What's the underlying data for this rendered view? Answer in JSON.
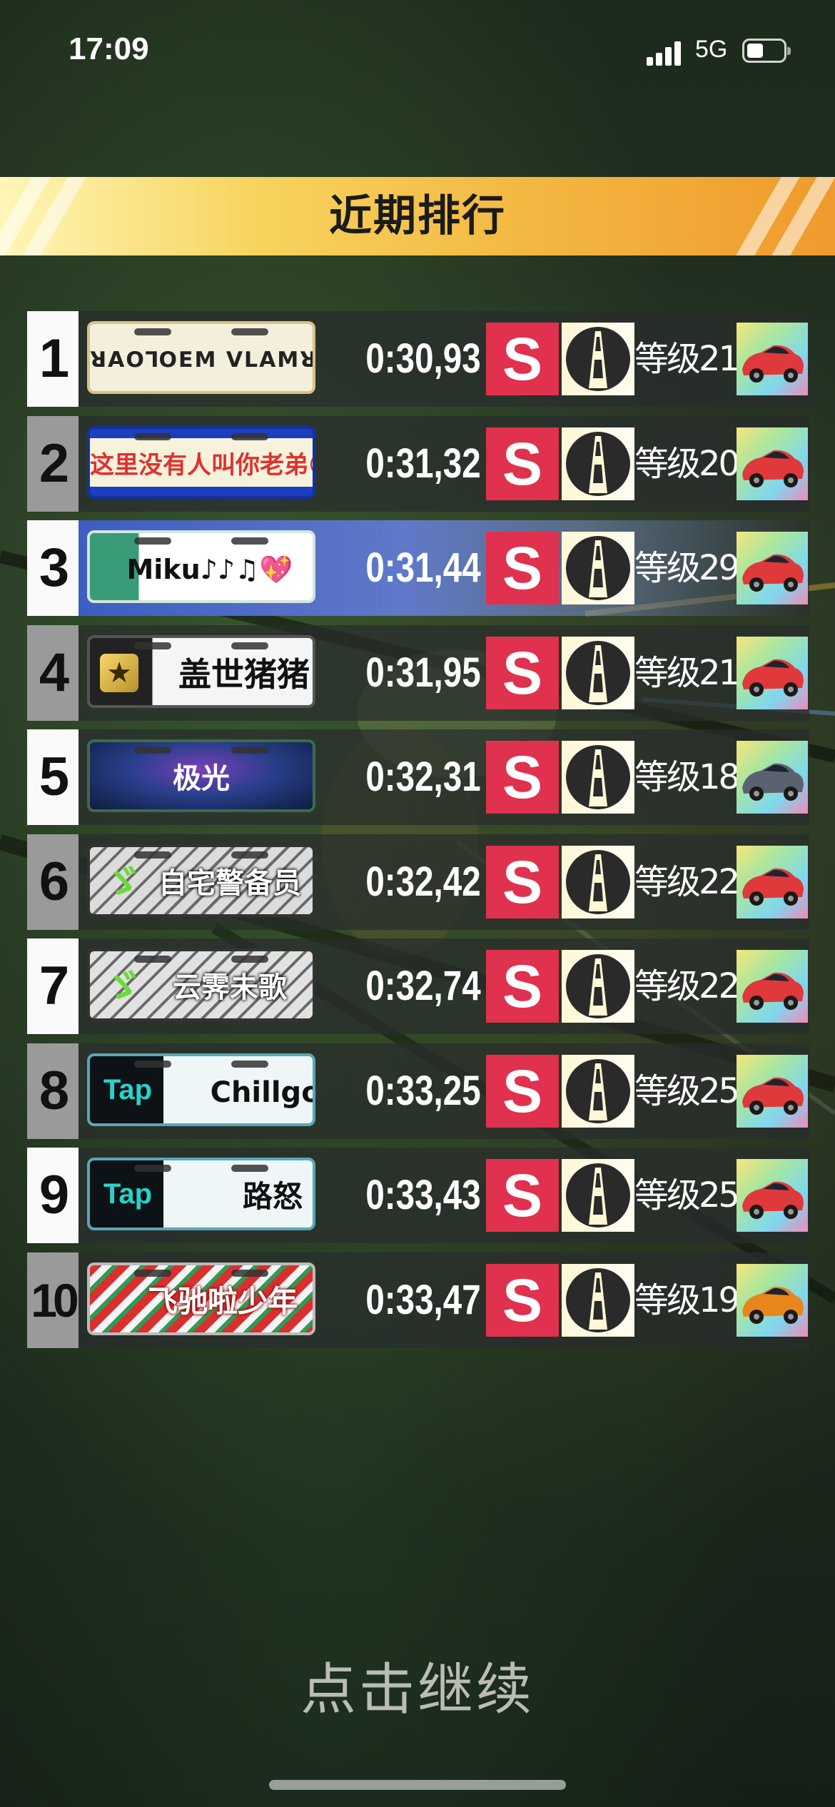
{
  "status_bar": {
    "time": "17:09",
    "network": "5G"
  },
  "title": "近期排行",
  "rows": [
    {
      "rank": "1",
      "plate": "ꓤꓮꓳꓶꓳꓰꓟ ꓦꓡꓮꓟꓤꓮ 🐌",
      "time": "0:30,93",
      "grade": "S",
      "level": "等级21",
      "highlight": false
    },
    {
      "rank": "2",
      "plate": "这里没有人叫你老弟😏",
      "time": "0:31,32",
      "grade": "S",
      "level": "等级20",
      "highlight": false
    },
    {
      "rank": "3",
      "plate": "Miku♪♪♫💖",
      "time": "0:31,44",
      "grade": "S",
      "level": "等级29",
      "highlight": true
    },
    {
      "rank": "4",
      "plate": "盖世猪猪",
      "time": "0:31,95",
      "grade": "S",
      "level": "等级21",
      "highlight": false
    },
    {
      "rank": "5",
      "plate": "极光",
      "time": "0:32,31",
      "grade": "S",
      "level": "等级18",
      "highlight": false
    },
    {
      "rank": "6",
      "plate": "自宅警备员",
      "time": "0:32,42",
      "grade": "S",
      "level": "等级22",
      "highlight": false
    },
    {
      "rank": "7",
      "plate": "云霁未歌",
      "time": "0:32,74",
      "grade": "S",
      "level": "等级22",
      "highlight": false
    },
    {
      "rank": "8",
      "plate": "Chillgor",
      "time": "0:33,25",
      "grade": "S",
      "level": "等级25",
      "highlight": false
    },
    {
      "rank": "9",
      "plate": "路怒",
      "time": "0:33,43",
      "grade": "S",
      "level": "等级25",
      "highlight": false
    },
    {
      "rank": "10",
      "plate": "飞驰啦少年",
      "time": "0:33,47",
      "grade": "S",
      "level": "等级19",
      "highlight": false
    }
  ],
  "plate_badges": {
    "tap": "Tap"
  },
  "continue_label": "点击继续",
  "colors": {
    "grade_bg": "#e0314e",
    "banner_start": "#fff6b8",
    "banner_end": "#ef9a2c",
    "highlight_row": "#3d5dc2"
  }
}
